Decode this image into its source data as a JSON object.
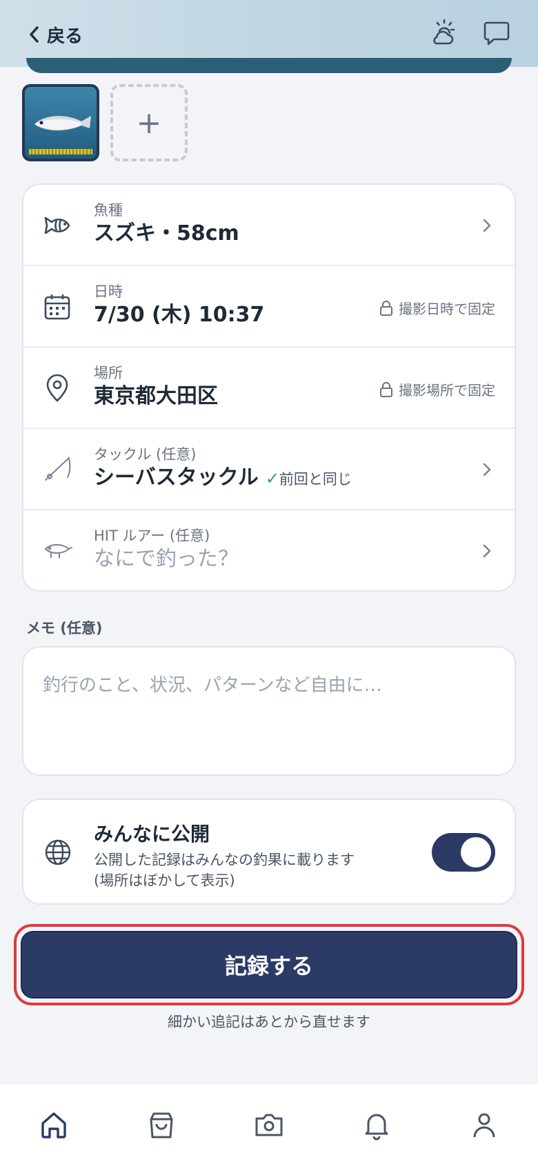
{
  "header": {
    "back_label": "戻る"
  },
  "fields": {
    "species": {
      "label": "魚種",
      "value": "スズキ・58cm"
    },
    "datetime": {
      "label": "日時",
      "value": "7/30 (木) 10:37",
      "lock_note": "撮影日時で固定"
    },
    "location": {
      "label": "場所",
      "value": "東京都大田区",
      "lock_note": "撮影場所で固定"
    },
    "tackle": {
      "label": "タックル (任意)",
      "value": "シーバスタックル",
      "same_note": "前回と同じ"
    },
    "lure": {
      "label": "HIT ルアー (任意)",
      "placeholder": "なにで釣った？"
    }
  },
  "memo": {
    "label": "メモ (任意)",
    "placeholder": "釣行のこと、状況、パターンなど自由に…"
  },
  "public": {
    "title": "みんなに公開",
    "description_line1": "公開した記録はみんなの釣果に載ります",
    "description_line2": "(場所はぼかして表示)",
    "enabled": true
  },
  "actions": {
    "submit_label": "記録する",
    "note": "細かい追記はあとから直せます"
  },
  "add_photo_symbol": "+",
  "colors": {
    "accent": "#2c3a66",
    "highlight": "#e03a3a",
    "check": "#2fa36b"
  },
  "icons": {
    "back": "chevron-left-icon",
    "weather": "sun-cloud-icon",
    "chat": "chat-bubble-icon"
  },
  "tabbar": {
    "items": [
      "home-icon",
      "shopping-bag-icon",
      "camera-icon",
      "bell-icon",
      "user-icon"
    ],
    "active": "home-icon"
  }
}
